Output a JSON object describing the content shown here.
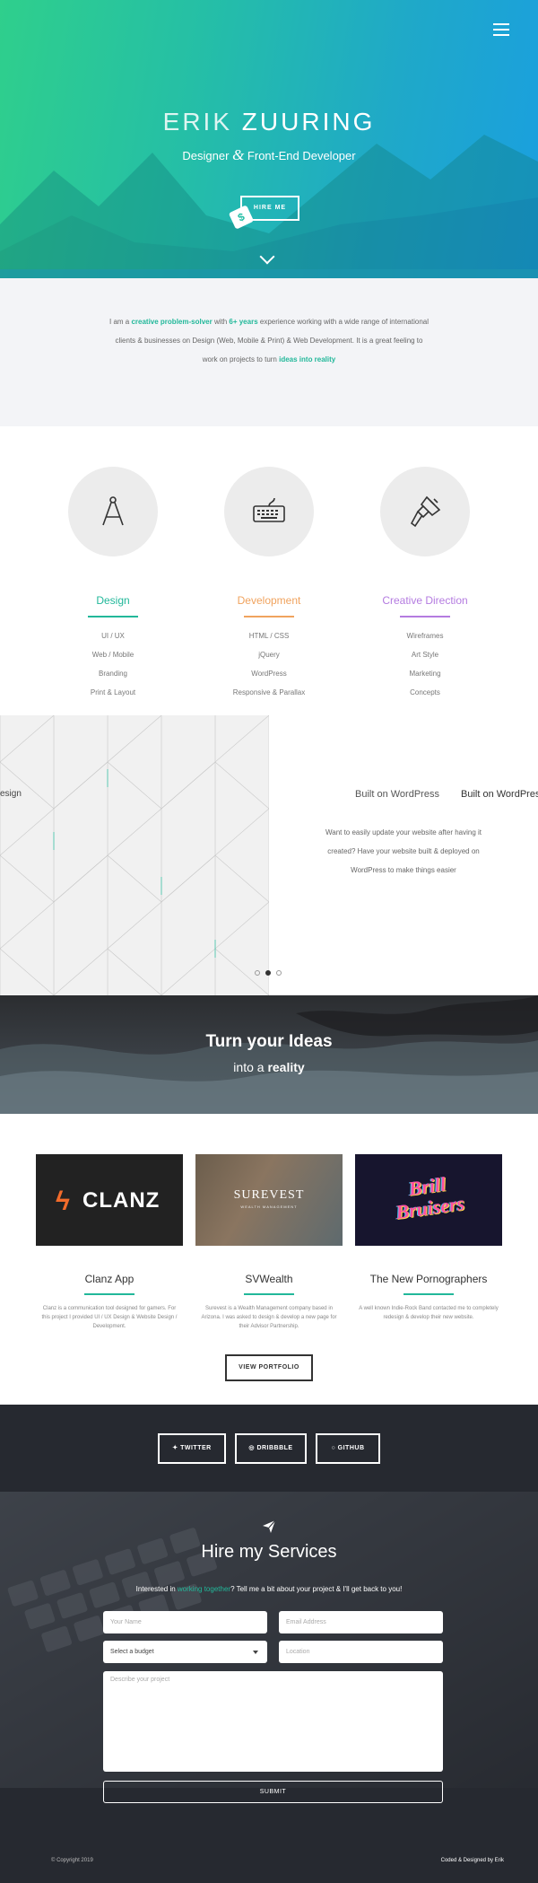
{
  "hero": {
    "first_name": "ERIK",
    "last_name": "ZUURING",
    "role_left": "Designer",
    "role_amp": "&",
    "role_right": "Front-End Developer",
    "hire_label": "HIRE ME",
    "tag_symbol": "$",
    "menu_icon": "hamburger-icon",
    "scroll_icon": "chevron-down-icon",
    "gradient": [
      "#2fcf8c",
      "#1a9fe0"
    ]
  },
  "intro": {
    "p1": "I am a ",
    "h1": "creative problem-solver",
    "p2": " with ",
    "h2": "6+ years",
    "p3": " experience working with a wide range of international clients & businesses on Design (Web, Mobile & Print) & Web Development. It is a great feeling to work on projects to turn ",
    "h3": "ideas into reality"
  },
  "skills": [
    {
      "title": "Design",
      "color": "#22b89a",
      "icon": "compass-icon",
      "items": [
        "UI / UX",
        "Web / Mobile",
        "Branding",
        "Print & Layout"
      ]
    },
    {
      "title": "Development",
      "color": "#f0a35e",
      "icon": "keyboard-icon",
      "items": [
        "HTML / CSS",
        "jQuery",
        "WordPress",
        "Responsive & Parallax"
      ]
    },
    {
      "title": "Creative Direction",
      "color": "#b47be0",
      "icon": "paintbrush-icon",
      "items": [
        "Wireframes",
        "Art Style",
        "Marketing",
        "Concepts"
      ]
    }
  ],
  "slider": {
    "left_partial": "esign",
    "ghost_title": "Built on WordPress",
    "title": "Built on WordPress",
    "text": "Want to easily update your website after having it created? Have your website built & deployed on WordPress to make things easier"
  },
  "ideas": {
    "heading": "Turn your Ideas",
    "sub_prefix": "into a ",
    "sub_bold": "reality"
  },
  "portfolio": {
    "projects": [
      {
        "title": "Clanz App",
        "thumb": "CLANZ",
        "thumb_symbol": "ϟ",
        "desc": "Clanz is a communication tool designed for gamers. For this project I provided UI / UX Design & Website Design / Development."
      },
      {
        "title": "SVWealth",
        "thumb": "SUREVEST",
        "thumb_sub": "WEALTH MANAGEMENT",
        "desc": "Surevest is a Wealth Management company based in Arizona. I was asked to design & develop a new page for their Advisor Partnership."
      },
      {
        "title": "The New Pornographers",
        "thumb": "Brill Bruisers",
        "desc": "A well known Indie-Rock Band contacted me to completely redesign & develop their new website."
      }
    ],
    "view_label": "VIEW PORTFOLIO"
  },
  "contact": {
    "social": [
      {
        "label": "TWITTER",
        "icon": "twitter-icon",
        "glyph": "✦"
      },
      {
        "label": "DRIBBBLE",
        "icon": "dribbble-icon",
        "glyph": "◎"
      },
      {
        "label": "GITHUB",
        "icon": "github-icon",
        "glyph": "○"
      }
    ],
    "heading": "Hire my Services",
    "lead_prefix": "Interested in ",
    "lead_link": "working together",
    "lead_suffix": "? Tell me a bit about your project & I'll get back to you!",
    "name_placeholder": "Your Name",
    "email_placeholder": "Email Address",
    "budget_value": "Select a budget",
    "location_placeholder": "Location",
    "project_placeholder": "Describe your project",
    "submit_label": "SUBMIT",
    "copyright": "© Copyright 2019",
    "credit": "Coded & Designed by Erik"
  },
  "colors": {
    "accent": "#22b89a",
    "dark": "#262930"
  }
}
